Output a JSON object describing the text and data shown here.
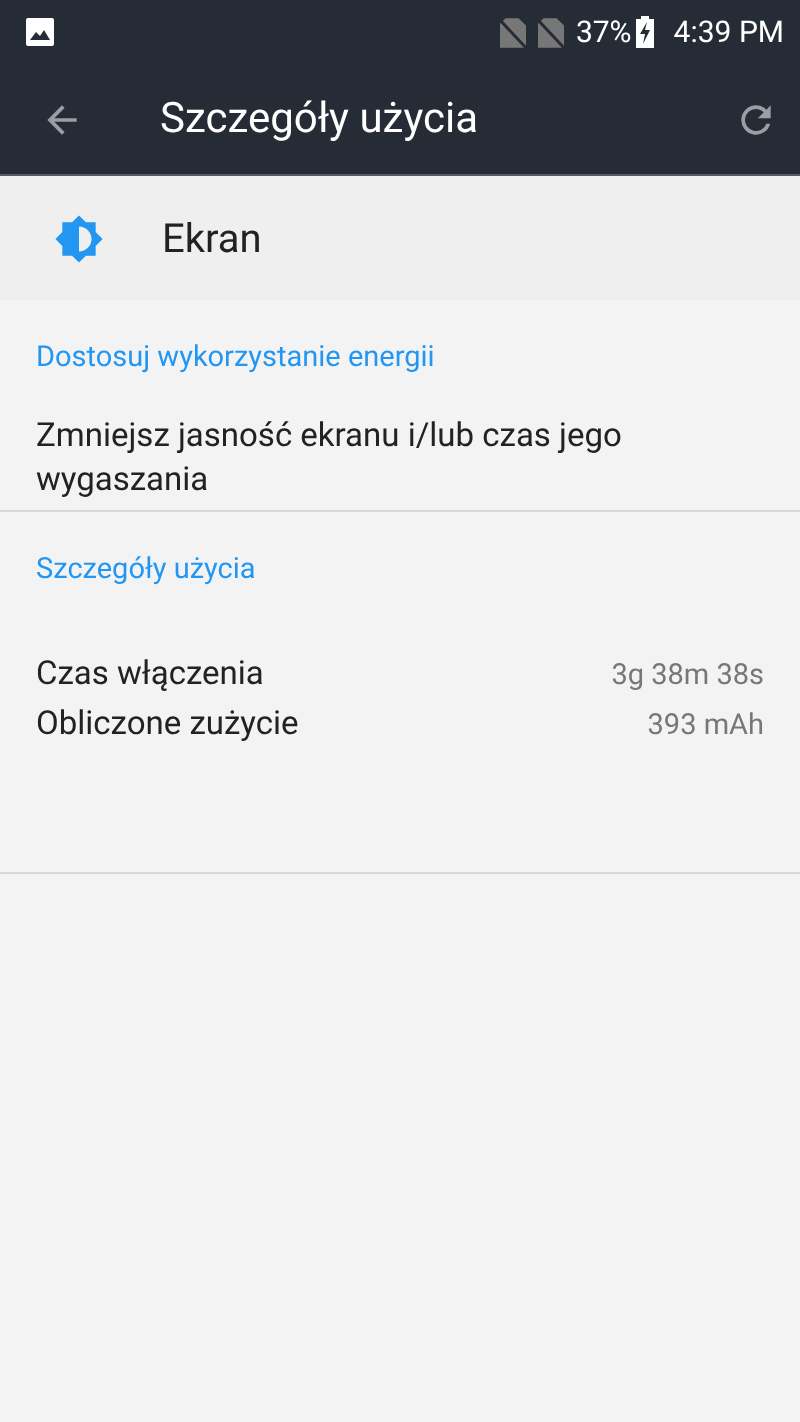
{
  "status_bar": {
    "battery": "37%",
    "time": "4:39 PM"
  },
  "toolbar": {
    "title": "Szczegóły użycia"
  },
  "app_header": {
    "name": "Ekran"
  },
  "sections": [
    {
      "title": "Dostosuj wykorzystanie energii",
      "kind": "text",
      "text": "Zmniejsz jasność ekranu i/lub czas jego wygaszania"
    },
    {
      "title": "Szczegóły użycia",
      "kind": "details",
      "rows": [
        {
          "label": "Czas włączenia",
          "value": "3g 38m 38s"
        },
        {
          "label": "Obliczone zużycie",
          "value": "393 mAh"
        }
      ]
    }
  ]
}
